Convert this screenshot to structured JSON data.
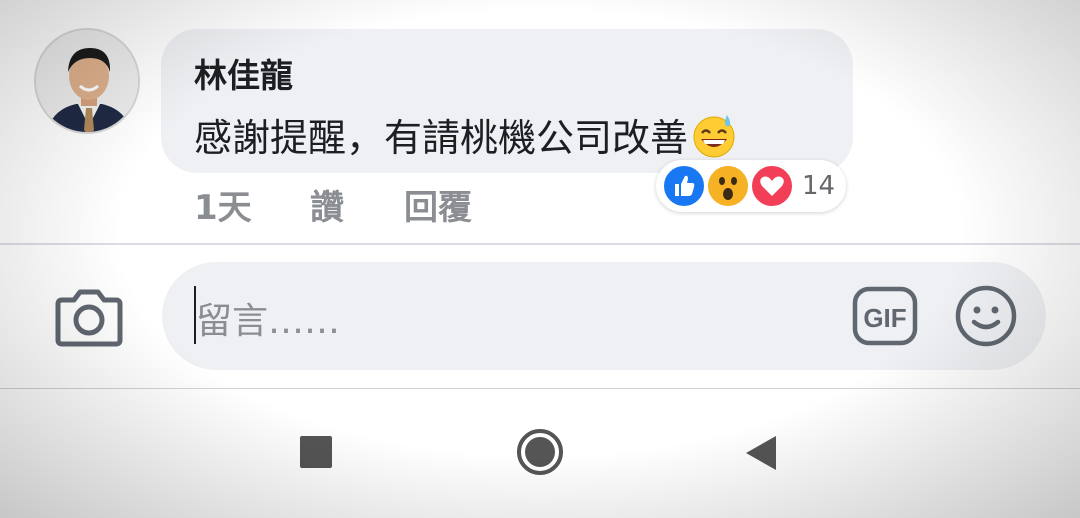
{
  "comment": {
    "author": "林佳龍",
    "text": "感謝提醒，有請桃機公司改善",
    "emoji": "grinning-sweat-emoji",
    "meta": {
      "time": "1天",
      "like_label": "讚",
      "reply_label": "回覆"
    },
    "reactions": {
      "icons": [
        "like-icon",
        "wow-icon",
        "love-icon"
      ],
      "count": "14"
    }
  },
  "composer": {
    "placeholder": "留言……",
    "gif_label": "GIF"
  },
  "colors": {
    "bubble": "#eef0f3",
    "like_blue": "#1877f2",
    "love_red": "#f33e58",
    "wow_yellow": "#f7b125",
    "secondary_text": "#8a8d91"
  }
}
